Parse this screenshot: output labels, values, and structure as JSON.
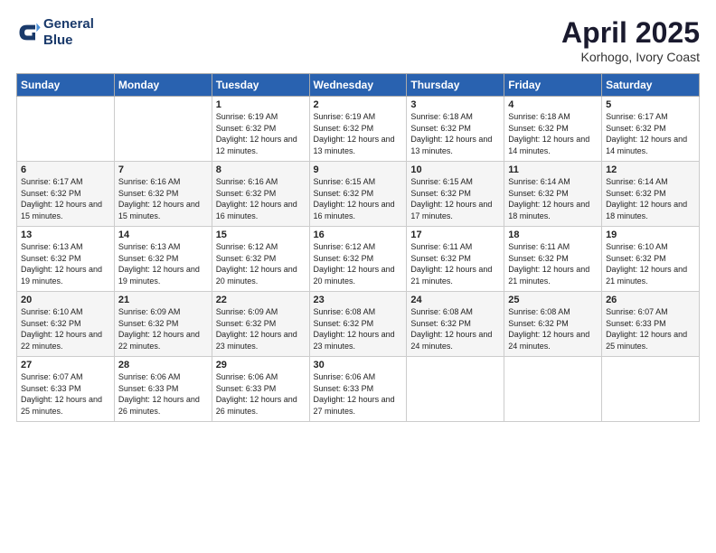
{
  "logo": {
    "line1": "General",
    "line2": "Blue"
  },
  "title": "April 2025",
  "subtitle": "Korhogo, Ivory Coast",
  "days_of_week": [
    "Sunday",
    "Monday",
    "Tuesday",
    "Wednesday",
    "Thursday",
    "Friday",
    "Saturday"
  ],
  "weeks": [
    [
      {
        "day": "",
        "sunrise": "",
        "sunset": "",
        "daylight": ""
      },
      {
        "day": "",
        "sunrise": "",
        "sunset": "",
        "daylight": ""
      },
      {
        "day": "1",
        "sunrise": "Sunrise: 6:19 AM",
        "sunset": "Sunset: 6:32 PM",
        "daylight": "Daylight: 12 hours and 12 minutes."
      },
      {
        "day": "2",
        "sunrise": "Sunrise: 6:19 AM",
        "sunset": "Sunset: 6:32 PM",
        "daylight": "Daylight: 12 hours and 13 minutes."
      },
      {
        "day": "3",
        "sunrise": "Sunrise: 6:18 AM",
        "sunset": "Sunset: 6:32 PM",
        "daylight": "Daylight: 12 hours and 13 minutes."
      },
      {
        "day": "4",
        "sunrise": "Sunrise: 6:18 AM",
        "sunset": "Sunset: 6:32 PM",
        "daylight": "Daylight: 12 hours and 14 minutes."
      },
      {
        "day": "5",
        "sunrise": "Sunrise: 6:17 AM",
        "sunset": "Sunset: 6:32 PM",
        "daylight": "Daylight: 12 hours and 14 minutes."
      }
    ],
    [
      {
        "day": "6",
        "sunrise": "Sunrise: 6:17 AM",
        "sunset": "Sunset: 6:32 PM",
        "daylight": "Daylight: 12 hours and 15 minutes."
      },
      {
        "day": "7",
        "sunrise": "Sunrise: 6:16 AM",
        "sunset": "Sunset: 6:32 PM",
        "daylight": "Daylight: 12 hours and 15 minutes."
      },
      {
        "day": "8",
        "sunrise": "Sunrise: 6:16 AM",
        "sunset": "Sunset: 6:32 PM",
        "daylight": "Daylight: 12 hours and 16 minutes."
      },
      {
        "day": "9",
        "sunrise": "Sunrise: 6:15 AM",
        "sunset": "Sunset: 6:32 PM",
        "daylight": "Daylight: 12 hours and 16 minutes."
      },
      {
        "day": "10",
        "sunrise": "Sunrise: 6:15 AM",
        "sunset": "Sunset: 6:32 PM",
        "daylight": "Daylight: 12 hours and 17 minutes."
      },
      {
        "day": "11",
        "sunrise": "Sunrise: 6:14 AM",
        "sunset": "Sunset: 6:32 PM",
        "daylight": "Daylight: 12 hours and 18 minutes."
      },
      {
        "day": "12",
        "sunrise": "Sunrise: 6:14 AM",
        "sunset": "Sunset: 6:32 PM",
        "daylight": "Daylight: 12 hours and 18 minutes."
      }
    ],
    [
      {
        "day": "13",
        "sunrise": "Sunrise: 6:13 AM",
        "sunset": "Sunset: 6:32 PM",
        "daylight": "Daylight: 12 hours and 19 minutes."
      },
      {
        "day": "14",
        "sunrise": "Sunrise: 6:13 AM",
        "sunset": "Sunset: 6:32 PM",
        "daylight": "Daylight: 12 hours and 19 minutes."
      },
      {
        "day": "15",
        "sunrise": "Sunrise: 6:12 AM",
        "sunset": "Sunset: 6:32 PM",
        "daylight": "Daylight: 12 hours and 20 minutes."
      },
      {
        "day": "16",
        "sunrise": "Sunrise: 6:12 AM",
        "sunset": "Sunset: 6:32 PM",
        "daylight": "Daylight: 12 hours and 20 minutes."
      },
      {
        "day": "17",
        "sunrise": "Sunrise: 6:11 AM",
        "sunset": "Sunset: 6:32 PM",
        "daylight": "Daylight: 12 hours and 21 minutes."
      },
      {
        "day": "18",
        "sunrise": "Sunrise: 6:11 AM",
        "sunset": "Sunset: 6:32 PM",
        "daylight": "Daylight: 12 hours and 21 minutes."
      },
      {
        "day": "19",
        "sunrise": "Sunrise: 6:10 AM",
        "sunset": "Sunset: 6:32 PM",
        "daylight": "Daylight: 12 hours and 21 minutes."
      }
    ],
    [
      {
        "day": "20",
        "sunrise": "Sunrise: 6:10 AM",
        "sunset": "Sunset: 6:32 PM",
        "daylight": "Daylight: 12 hours and 22 minutes."
      },
      {
        "day": "21",
        "sunrise": "Sunrise: 6:09 AM",
        "sunset": "Sunset: 6:32 PM",
        "daylight": "Daylight: 12 hours and 22 minutes."
      },
      {
        "day": "22",
        "sunrise": "Sunrise: 6:09 AM",
        "sunset": "Sunset: 6:32 PM",
        "daylight": "Daylight: 12 hours and 23 minutes."
      },
      {
        "day": "23",
        "sunrise": "Sunrise: 6:08 AM",
        "sunset": "Sunset: 6:32 PM",
        "daylight": "Daylight: 12 hours and 23 minutes."
      },
      {
        "day": "24",
        "sunrise": "Sunrise: 6:08 AM",
        "sunset": "Sunset: 6:32 PM",
        "daylight": "Daylight: 12 hours and 24 minutes."
      },
      {
        "day": "25",
        "sunrise": "Sunrise: 6:08 AM",
        "sunset": "Sunset: 6:32 PM",
        "daylight": "Daylight: 12 hours and 24 minutes."
      },
      {
        "day": "26",
        "sunrise": "Sunrise: 6:07 AM",
        "sunset": "Sunset: 6:33 PM",
        "daylight": "Daylight: 12 hours and 25 minutes."
      }
    ],
    [
      {
        "day": "27",
        "sunrise": "Sunrise: 6:07 AM",
        "sunset": "Sunset: 6:33 PM",
        "daylight": "Daylight: 12 hours and 25 minutes."
      },
      {
        "day": "28",
        "sunrise": "Sunrise: 6:06 AM",
        "sunset": "Sunset: 6:33 PM",
        "daylight": "Daylight: 12 hours and 26 minutes."
      },
      {
        "day": "29",
        "sunrise": "Sunrise: 6:06 AM",
        "sunset": "Sunset: 6:33 PM",
        "daylight": "Daylight: 12 hours and 26 minutes."
      },
      {
        "day": "30",
        "sunrise": "Sunrise: 6:06 AM",
        "sunset": "Sunset: 6:33 PM",
        "daylight": "Daylight: 12 hours and 27 minutes."
      },
      {
        "day": "",
        "sunrise": "",
        "sunset": "",
        "daylight": ""
      },
      {
        "day": "",
        "sunrise": "",
        "sunset": "",
        "daylight": ""
      },
      {
        "day": "",
        "sunrise": "",
        "sunset": "",
        "daylight": ""
      }
    ]
  ]
}
